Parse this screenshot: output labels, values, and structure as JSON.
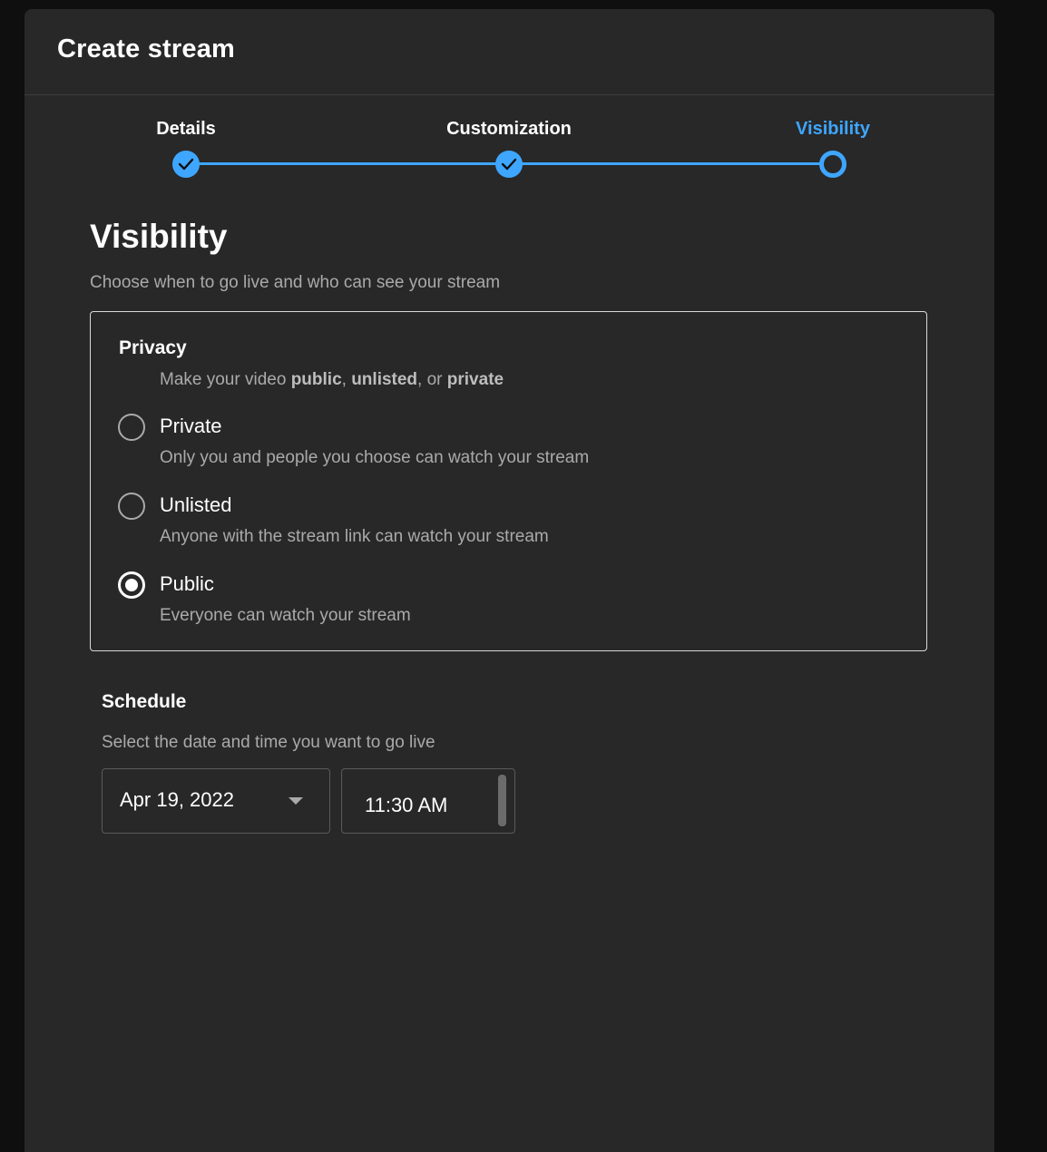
{
  "dialog": {
    "title": "Create stream"
  },
  "stepper": {
    "steps": [
      {
        "label": "Details",
        "state": "done"
      },
      {
        "label": "Customization",
        "state": "done"
      },
      {
        "label": "Visibility",
        "state": "current"
      }
    ]
  },
  "visibility": {
    "title": "Visibility",
    "subtitle": "Choose when to go live and who can see your stream"
  },
  "privacy": {
    "title": "Privacy",
    "desc_prefix": "Make your video ",
    "desc_public": "public",
    "desc_sep1": ", ",
    "desc_unlisted": "unlisted",
    "desc_sep2": ", or ",
    "desc_private": "private",
    "options": [
      {
        "label": "Private",
        "desc": "Only you and people you choose can watch your stream",
        "checked": false
      },
      {
        "label": "Unlisted",
        "desc": "Anyone with the stream link can watch your stream",
        "checked": false
      },
      {
        "label": "Public",
        "desc": "Everyone can watch your stream",
        "checked": true
      }
    ]
  },
  "schedule": {
    "title": "Schedule",
    "subtitle": "Select the date and time you want to go live",
    "date": "Apr 19, 2022",
    "time": "11:30 AM"
  },
  "colors": {
    "background": "#282828",
    "accent": "#3ea6ff",
    "text_primary": "#ffffff",
    "text_secondary": "#aaaaaa"
  },
  "icons": {
    "step_done": "check-icon",
    "date_dropdown": "chevron-down-icon"
  }
}
